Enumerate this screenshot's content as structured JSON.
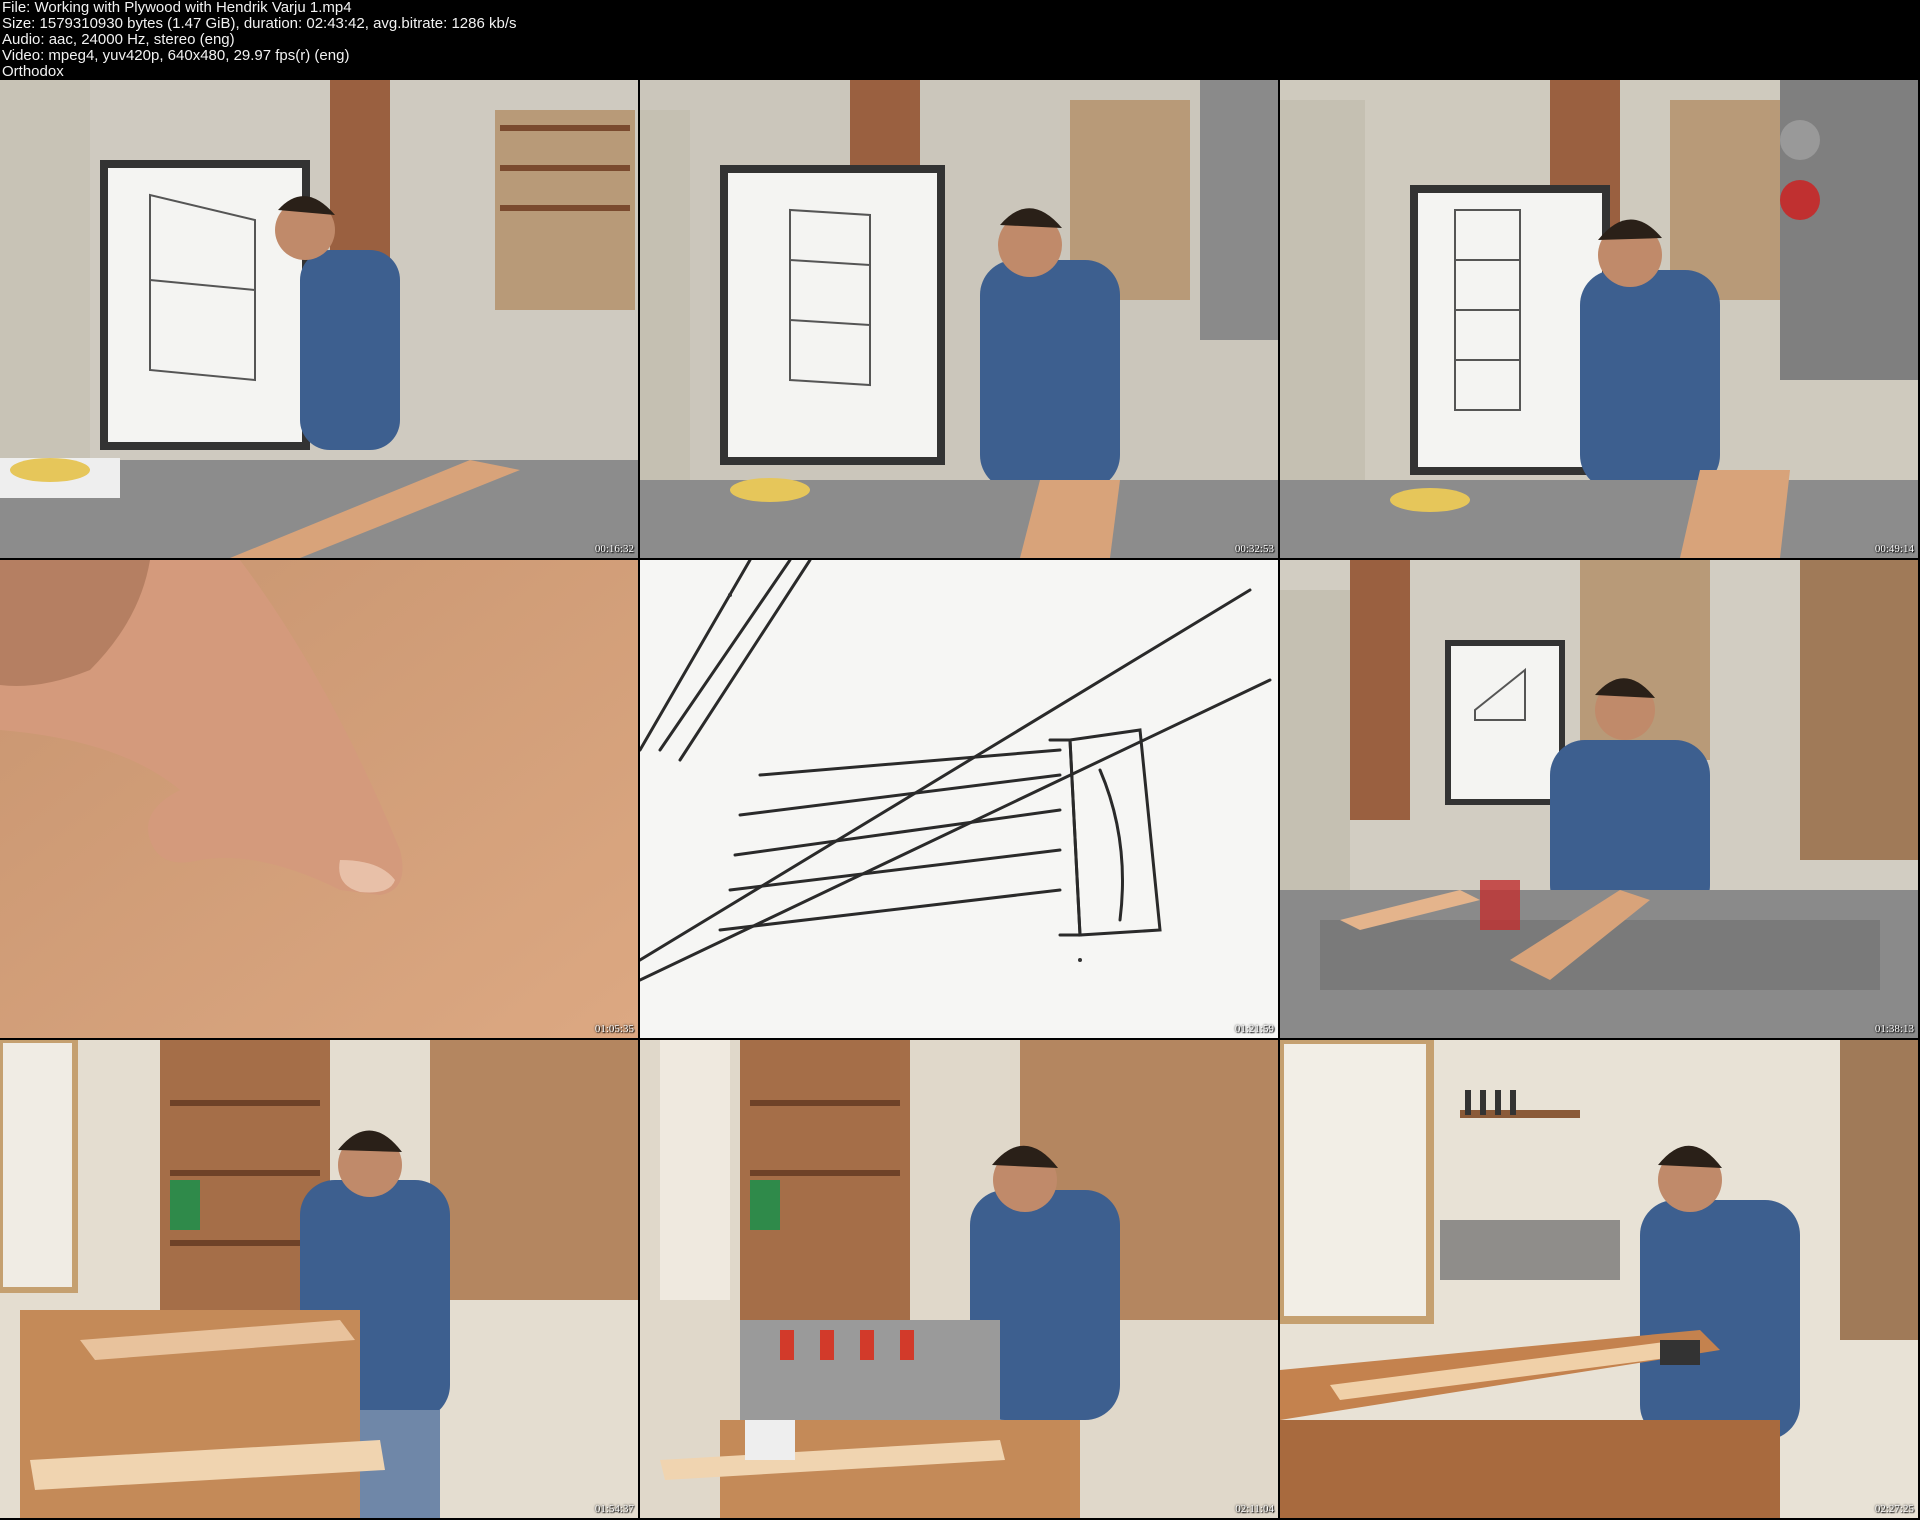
{
  "header": {
    "file": "File: Working with Plywood with Hendrik Varju 1.mp4",
    "size": "Size: 1579310930 bytes (1.47 GiB), duration: 02:43:42, avg.bitrate: 1286 kb/s",
    "audio": "Audio: aac, 24000 Hz, stereo (eng)",
    "video": "Video: mpeg4, yuv420p, 640x480, 29.97 fps(r) (eng)",
    "tag": "Orthodox"
  },
  "thumbnails": [
    {
      "timestamp": "00:16:32",
      "scene": "whiteboard-drawing"
    },
    {
      "timestamp": "00:32:53",
      "scene": "whiteboard-explaining"
    },
    {
      "timestamp": "00:49:14",
      "scene": "whiteboard-dimensions"
    },
    {
      "timestamp": "01:05:35",
      "scene": "hand-on-plywood"
    },
    {
      "timestamp": "01:21:59",
      "scene": "edge-banding-sketch"
    },
    {
      "timestamp": "01:38:13",
      "scene": "table-saw-cutting"
    },
    {
      "timestamp": "01:54:37",
      "scene": "workbench-panels"
    },
    {
      "timestamp": "02:11:04",
      "scene": "clamping-glue-up"
    },
    {
      "timestamp": "02:27:25",
      "scene": "hand-planing"
    }
  ],
  "colors": {
    "shirt": "#3d5f8f",
    "jeans": "#6f87a8",
    "wall": "#d9d4c6",
    "plywood": "#d8a37a",
    "whiteboard": "#f4f4f2"
  }
}
